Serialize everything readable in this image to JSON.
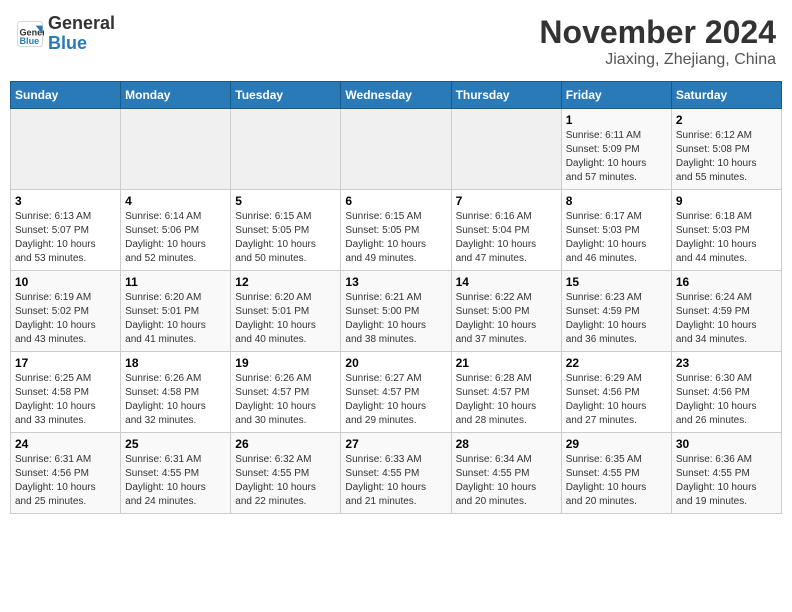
{
  "header": {
    "logo_line1": "General",
    "logo_line2": "Blue",
    "month": "November 2024",
    "location": "Jiaxing, Zhejiang, China"
  },
  "weekdays": [
    "Sunday",
    "Monday",
    "Tuesday",
    "Wednesday",
    "Thursday",
    "Friday",
    "Saturday"
  ],
  "weeks": [
    [
      {
        "day": "",
        "info": ""
      },
      {
        "day": "",
        "info": ""
      },
      {
        "day": "",
        "info": ""
      },
      {
        "day": "",
        "info": ""
      },
      {
        "day": "",
        "info": ""
      },
      {
        "day": "1",
        "info": "Sunrise: 6:11 AM\nSunset: 5:09 PM\nDaylight: 10 hours\nand 57 minutes."
      },
      {
        "day": "2",
        "info": "Sunrise: 6:12 AM\nSunset: 5:08 PM\nDaylight: 10 hours\nand 55 minutes."
      }
    ],
    [
      {
        "day": "3",
        "info": "Sunrise: 6:13 AM\nSunset: 5:07 PM\nDaylight: 10 hours\nand 53 minutes."
      },
      {
        "day": "4",
        "info": "Sunrise: 6:14 AM\nSunset: 5:06 PM\nDaylight: 10 hours\nand 52 minutes."
      },
      {
        "day": "5",
        "info": "Sunrise: 6:15 AM\nSunset: 5:05 PM\nDaylight: 10 hours\nand 50 minutes."
      },
      {
        "day": "6",
        "info": "Sunrise: 6:15 AM\nSunset: 5:05 PM\nDaylight: 10 hours\nand 49 minutes."
      },
      {
        "day": "7",
        "info": "Sunrise: 6:16 AM\nSunset: 5:04 PM\nDaylight: 10 hours\nand 47 minutes."
      },
      {
        "day": "8",
        "info": "Sunrise: 6:17 AM\nSunset: 5:03 PM\nDaylight: 10 hours\nand 46 minutes."
      },
      {
        "day": "9",
        "info": "Sunrise: 6:18 AM\nSunset: 5:03 PM\nDaylight: 10 hours\nand 44 minutes."
      }
    ],
    [
      {
        "day": "10",
        "info": "Sunrise: 6:19 AM\nSunset: 5:02 PM\nDaylight: 10 hours\nand 43 minutes."
      },
      {
        "day": "11",
        "info": "Sunrise: 6:20 AM\nSunset: 5:01 PM\nDaylight: 10 hours\nand 41 minutes."
      },
      {
        "day": "12",
        "info": "Sunrise: 6:20 AM\nSunset: 5:01 PM\nDaylight: 10 hours\nand 40 minutes."
      },
      {
        "day": "13",
        "info": "Sunrise: 6:21 AM\nSunset: 5:00 PM\nDaylight: 10 hours\nand 38 minutes."
      },
      {
        "day": "14",
        "info": "Sunrise: 6:22 AM\nSunset: 5:00 PM\nDaylight: 10 hours\nand 37 minutes."
      },
      {
        "day": "15",
        "info": "Sunrise: 6:23 AM\nSunset: 4:59 PM\nDaylight: 10 hours\nand 36 minutes."
      },
      {
        "day": "16",
        "info": "Sunrise: 6:24 AM\nSunset: 4:59 PM\nDaylight: 10 hours\nand 34 minutes."
      }
    ],
    [
      {
        "day": "17",
        "info": "Sunrise: 6:25 AM\nSunset: 4:58 PM\nDaylight: 10 hours\nand 33 minutes."
      },
      {
        "day": "18",
        "info": "Sunrise: 6:26 AM\nSunset: 4:58 PM\nDaylight: 10 hours\nand 32 minutes."
      },
      {
        "day": "19",
        "info": "Sunrise: 6:26 AM\nSunset: 4:57 PM\nDaylight: 10 hours\nand 30 minutes."
      },
      {
        "day": "20",
        "info": "Sunrise: 6:27 AM\nSunset: 4:57 PM\nDaylight: 10 hours\nand 29 minutes."
      },
      {
        "day": "21",
        "info": "Sunrise: 6:28 AM\nSunset: 4:57 PM\nDaylight: 10 hours\nand 28 minutes."
      },
      {
        "day": "22",
        "info": "Sunrise: 6:29 AM\nSunset: 4:56 PM\nDaylight: 10 hours\nand 27 minutes."
      },
      {
        "day": "23",
        "info": "Sunrise: 6:30 AM\nSunset: 4:56 PM\nDaylight: 10 hours\nand 26 minutes."
      }
    ],
    [
      {
        "day": "24",
        "info": "Sunrise: 6:31 AM\nSunset: 4:56 PM\nDaylight: 10 hours\nand 25 minutes."
      },
      {
        "day": "25",
        "info": "Sunrise: 6:31 AM\nSunset: 4:55 PM\nDaylight: 10 hours\nand 24 minutes."
      },
      {
        "day": "26",
        "info": "Sunrise: 6:32 AM\nSunset: 4:55 PM\nDaylight: 10 hours\nand 22 minutes."
      },
      {
        "day": "27",
        "info": "Sunrise: 6:33 AM\nSunset: 4:55 PM\nDaylight: 10 hours\nand 21 minutes."
      },
      {
        "day": "28",
        "info": "Sunrise: 6:34 AM\nSunset: 4:55 PM\nDaylight: 10 hours\nand 20 minutes."
      },
      {
        "day": "29",
        "info": "Sunrise: 6:35 AM\nSunset: 4:55 PM\nDaylight: 10 hours\nand 20 minutes."
      },
      {
        "day": "30",
        "info": "Sunrise: 6:36 AM\nSunset: 4:55 PM\nDaylight: 10 hours\nand 19 minutes."
      }
    ]
  ]
}
